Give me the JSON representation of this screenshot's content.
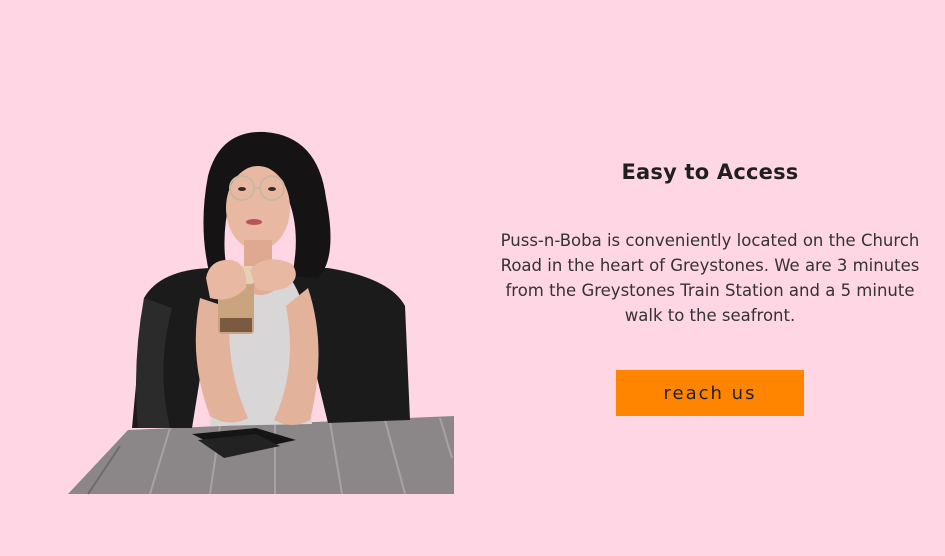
{
  "access": {
    "heading": "Easy to Access",
    "description": "Puss-n-Boba is conveniently located on the Church Road in the heart of Greystones. We are 3 minutes from the Greystones Train Station and a 5 minute walk to the seafront.",
    "button_label": "reach us"
  },
  "colors": {
    "background": "#ffd6e3",
    "button": "#ff8500",
    "heading": "#1f1f1f",
    "text": "#333333"
  },
  "icons": {
    "photo": "woman-with-boba-drink-photo"
  }
}
